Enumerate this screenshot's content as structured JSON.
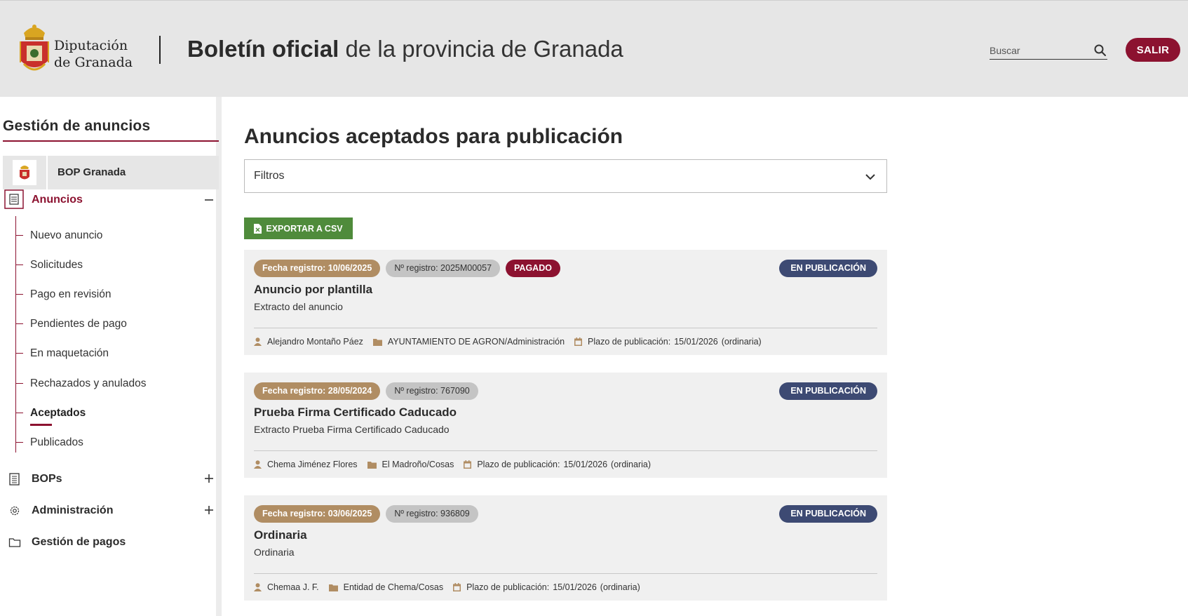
{
  "header": {
    "org_name_line1": "Diputación",
    "org_name_line2": "de Granada",
    "title_bold": "Boletín oficial",
    "title_rest": " de la provincia de Granada",
    "search_placeholder": "Buscar",
    "logout_label": "SALIR"
  },
  "sidebar": {
    "title": "Gestión de anuncios",
    "entity_label": "BOP Granada",
    "anuncios": {
      "label": "Anuncios",
      "items": [
        {
          "label": "Nuevo anuncio"
        },
        {
          "label": "Solicitudes"
        },
        {
          "label": "Pago en revisión"
        },
        {
          "label": "Pendientes de pago"
        },
        {
          "label": "En maquetación"
        },
        {
          "label": "Rechazados y anulados"
        },
        {
          "label": "Aceptados"
        },
        {
          "label": "Publicados"
        }
      ]
    },
    "bops_label": "BOPs",
    "admin_label": "Administración",
    "payments_label": "Gestión de pagos"
  },
  "main": {
    "title": "Anuncios aceptados para publicación",
    "filters_label": "Filtros",
    "export_label": "EXPORTAR A CSV",
    "cards": [
      {
        "date": "Fecha registro: 10/06/2025",
        "reg": "Nº registro: 2025M00057",
        "paid": "PAGADO",
        "status": "EN PUBLICACIÓN",
        "title": "Anuncio por plantilla",
        "extract": "Extracto del anuncio",
        "user": "Alejandro Montaño Páez",
        "org": "AYUNTAMIENTO DE AGRON/Administración",
        "plazo_label": "Plazo de publicación:",
        "plazo_date": "15/01/2026",
        "plazo_type": "(ordinaria)"
      },
      {
        "date": "Fecha registro: 28/05/2024",
        "reg": "Nº registro: 767090",
        "status": "EN PUBLICACIÓN",
        "title": "Prueba Firma Certificado Caducado",
        "extract": "Extracto Prueba Firma Certificado Caducado",
        "user": "Chema Jiménez Flores",
        "org": "El Madroño/Cosas",
        "plazo_label": "Plazo de publicación:",
        "plazo_date": "15/01/2026",
        "plazo_type": "(ordinaria)"
      },
      {
        "date": "Fecha registro: 03/06/2025",
        "reg": "Nº registro: 936809",
        "status": "EN PUBLICACIÓN",
        "title": "Ordinaria",
        "extract": "Ordinaria",
        "user": "Chemaa J. F.",
        "org": "Entidad de Chema/Cosas",
        "plazo_label": "Plazo de publicación:",
        "plazo_date": "15/01/2026",
        "plazo_type": "(ordinaria)"
      }
    ]
  },
  "colors": {
    "brand": "#8c1230",
    "status_badge": "#3d4a73",
    "date_badge": "#b08d63",
    "export_green": "#4f8b3b"
  }
}
